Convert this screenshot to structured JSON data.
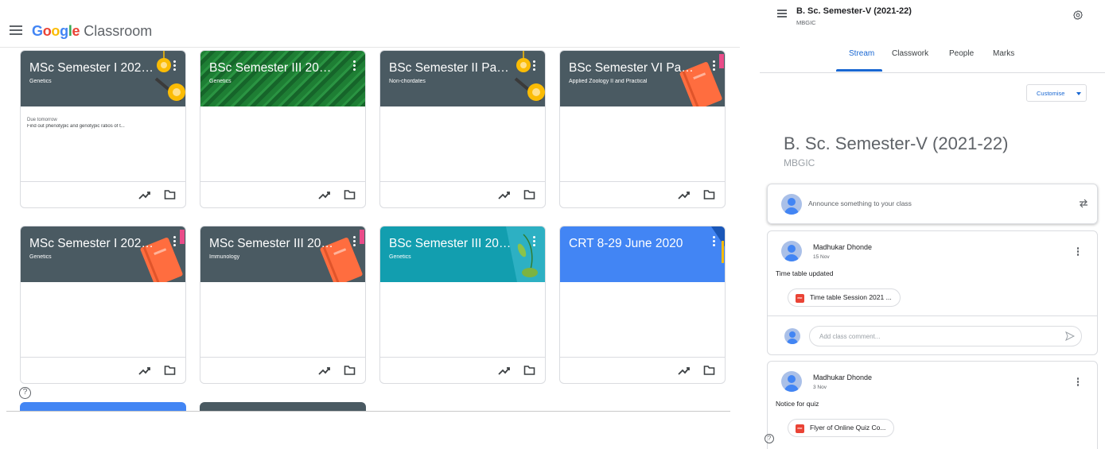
{
  "classroom": {
    "brand": {
      "google": [
        "G",
        "o",
        "o",
        "g",
        "l",
        "e"
      ],
      "product": "Classroom"
    },
    "colors": {
      "blue": "#4285f4",
      "red": "#ea4335",
      "yellow": "#fbbc05",
      "green": "#34a853",
      "slate": "#4a5a62",
      "lab_green": "#1e7e34",
      "teal": "#129eaf",
      "crt_blue": "#4285f4"
    },
    "cards": [
      {
        "title": "MSc Semester I 2021...",
        "subtitle": "Genetics",
        "due_label": "Due tomorrow",
        "due_text": "Find out phenotypic and genotypic ratios of t...",
        "banner": "slate",
        "art": "bulb"
      },
      {
        "title": "BSc Semester III 2021...",
        "subtitle": "Genetics",
        "due_label": "",
        "due_text": "",
        "banner": "lab_green",
        "art": "none"
      },
      {
        "title": "BSc Semester II Pape...",
        "subtitle": "Non-chordates",
        "due_label": "",
        "due_text": "",
        "banner": "slate",
        "art": "bulb"
      },
      {
        "title": "BSc Semester VI Pap...",
        "subtitle": "Applied Zoology II and Practical",
        "due_label": "",
        "due_text": "",
        "banner": "slate",
        "art": "book"
      },
      {
        "title": "MSc Semester I 2020...",
        "subtitle": "Genetics",
        "due_label": "",
        "due_text": "",
        "banner": "slate",
        "art": "book"
      },
      {
        "title": "MSc Semester III 202...",
        "subtitle": "Immunology",
        "due_label": "",
        "due_text": "",
        "banner": "slate",
        "art": "book"
      },
      {
        "title": "BSc Semester III 202...",
        "subtitle": "Genetics",
        "due_label": "",
        "due_text": "",
        "banner": "teal",
        "art": "leaf"
      },
      {
        "title": "CRT 8-29 June 2020",
        "subtitle": "",
        "due_label": "",
        "due_text": "",
        "banner": "crt_blue",
        "art": "corner"
      }
    ],
    "help_label": "?"
  },
  "class_page": {
    "header_title": "B. Sc. Semester-V (2021-22)",
    "header_subtitle": "MBGIC",
    "tabs": [
      "Stream",
      "Classwork",
      "People",
      "Marks"
    ],
    "active_tab": "Stream",
    "customise_label": "Customise",
    "banner_title": "B. Sc. Semester-V (2021-22)",
    "banner_subtitle": "MBGIC",
    "announce_placeholder": "Announce something to your class",
    "posts": [
      {
        "author": "Madhukar Dhonde",
        "date": "15 Nov",
        "text": "Time table updated",
        "attachment": "Time table Session 2021 ...",
        "comment_placeholder": "Add class comment..."
      },
      {
        "author": "Madhukar Dhonde",
        "date": "3 Nov",
        "text": "Notice for quiz",
        "attachment": "Flyer of Online Quiz Co..."
      }
    ],
    "pdf_badge": "PDF",
    "help_label": "?"
  }
}
